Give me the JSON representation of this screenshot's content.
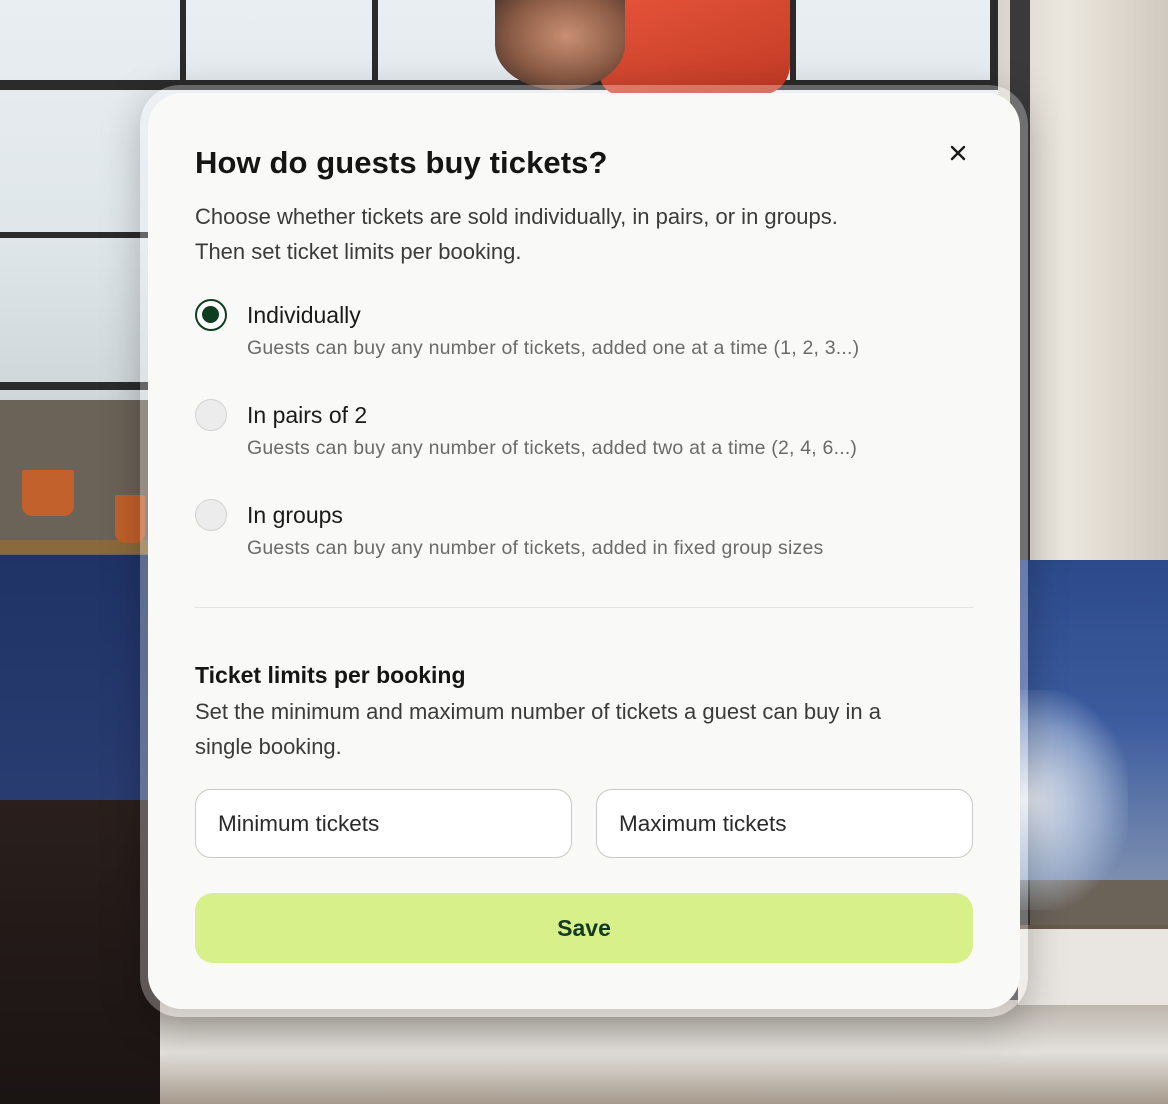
{
  "modal": {
    "title": "How do guests buy tickets?",
    "subtitle": "Choose whether tickets are sold individually, in pairs, or in groups. Then set ticket limits per booking.",
    "close_icon": "close-icon",
    "options": [
      {
        "label": "Individually",
        "description": "Guests can buy any number of tickets, added one at a time (1, 2, 3...)",
        "selected": true
      },
      {
        "label": "In pairs of 2",
        "description": "Guests can buy any number of tickets, added two at a time (2, 4, 6...)",
        "selected": false
      },
      {
        "label": "In groups",
        "description": "Guests can buy any number of tickets, added in fixed group sizes",
        "selected": false
      }
    ],
    "limits": {
      "title": "Ticket limits per booking",
      "description": "Set the minimum and maximum number of tickets a guest can buy in a single booking.",
      "min_placeholder": "Minimum tickets",
      "max_placeholder": "Maximum tickets",
      "min_value": "",
      "max_value": ""
    },
    "save_label": "Save"
  },
  "colors": {
    "accent": "#d7f08a",
    "accent_text": "#133a1e",
    "radio_selected": "#0f3d20"
  }
}
